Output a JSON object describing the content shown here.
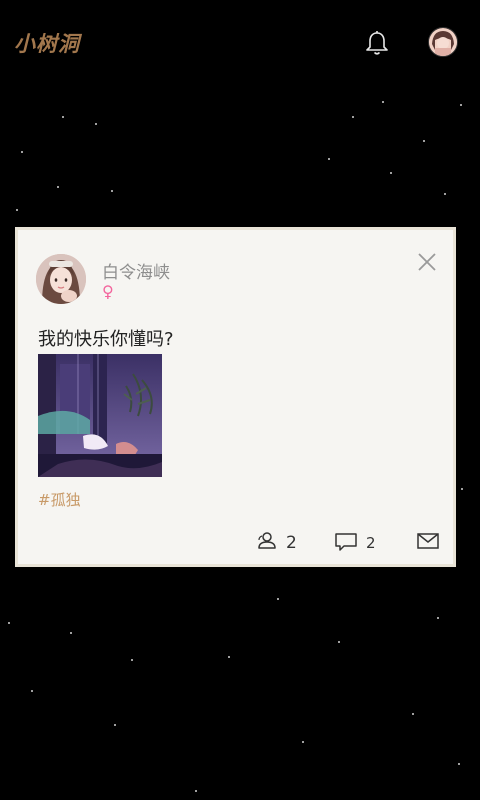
{
  "header": {
    "app_title": "小树洞",
    "bell_icon": "bell-icon",
    "profile_icon": "avatar"
  },
  "post": {
    "author_name": "白令海峡",
    "gender_symbol": "♀",
    "text": "我的快乐你懂吗?",
    "hashtag": "#孤独",
    "likes_count": "2",
    "comments_count": "2",
    "icons": {
      "close": "close-icon",
      "like": "people-icon",
      "comment": "comment-icon",
      "message": "mail-icon"
    },
    "colors": {
      "accent": "#c89a68",
      "gender": "#f3659d",
      "title": "#a2774d"
    }
  }
}
